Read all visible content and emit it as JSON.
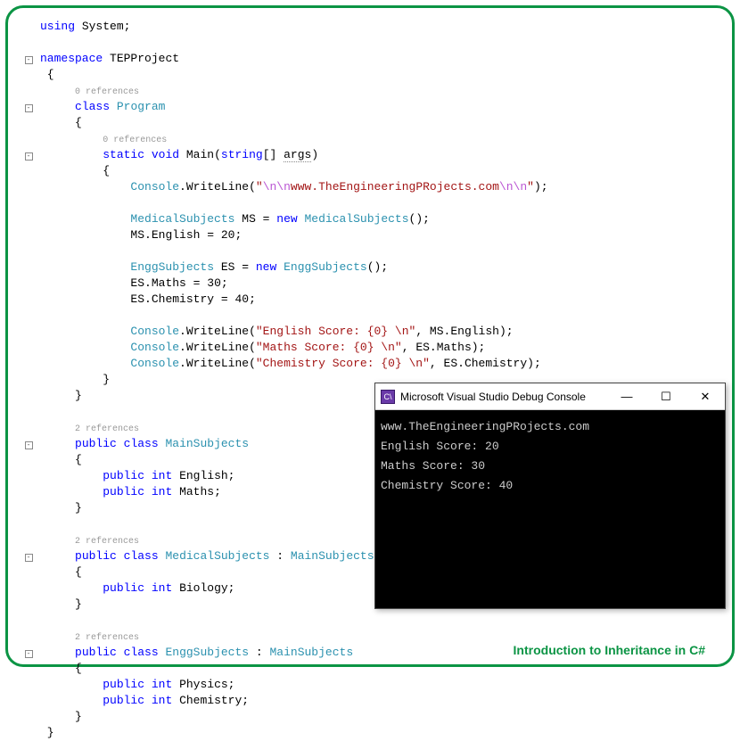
{
  "caption": "Introduction to Inheritance in C#",
  "code": {
    "using": "using",
    "system": "System",
    "namespace_kw": "namespace",
    "namespace_name": "TEPProject",
    "class_kw": "class",
    "public_kw": "public",
    "static_kw": "static",
    "void_kw": "void",
    "int_kw": "int",
    "new_kw": "new",
    "string_arr": "string",
    "program": "Program",
    "main": "Main",
    "args": "args",
    "console": "Console",
    "writeline": "WriteLine",
    "ref0": "0 references",
    "ref2": "2 references",
    "mainsubjects": "MainSubjects",
    "medicalsubjects": "MedicalSubjects",
    "enggsubjects": "EnggSubjects",
    "english": "English",
    "maths": "Maths",
    "biology": "Biology",
    "physics": "Physics",
    "chemistry": "Chemistry",
    "ms": "MS",
    "es": "ES",
    "val20": "20",
    "val30": "30",
    "val40": "40",
    "url_str": "www.TheEngineeringPRojects.com",
    "eng_str": "\"English Score: {0} \\n\"",
    "math_str": "\"Maths Score: {0} \\n\"",
    "chem_str": "\"Chemistry Score: {0} \\n\"",
    "esc_nn": "\\n\\n",
    "colon": " : "
  },
  "console": {
    "title": "Microsoft Visual Studio Debug Console",
    "icon_text": "C\\",
    "minimize": "—",
    "maximize": "☐",
    "close": "✕",
    "lines": {
      "blank": "",
      "l1": "www.TheEngineeringPRojects.com",
      "l2": "English Score: 20",
      "l3": "Maths Score: 30",
      "l4": "Chemistry Score: 40"
    }
  }
}
